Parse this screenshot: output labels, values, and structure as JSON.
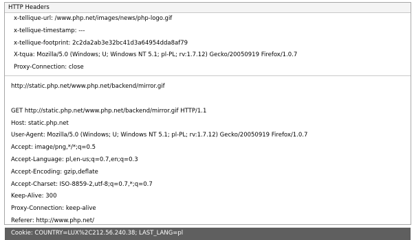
{
  "title": "HTTP Headers",
  "response_headers": [
    "x-tellique-url: /www.php.net/images/news/php-logo.gif",
    "x-tellique-timestamp: ---",
    "x-tellique-footprint: 2c2da2ab3e32bc41d3a64954dda8af79",
    "X-tqua: Mozilla/5.0 (Windows; U; Windows NT 5.1; pl-PL; rv:1.7.12) Gecko/20050919 Firefox/1.0.7",
    "Proxy-Connection: close"
  ],
  "request_url": "http://static.php.net/www.php.net/backend/mirror.gif",
  "request_headers": [
    "GET http://static.php.net/www.php.net/backend/mirror.gif HTTP/1.1",
    "Host: static.php.net",
    "User-Agent: Mozilla/5.0 (Windows; U; Windows NT 5.1; pl-PL; rv:1.7.12) Gecko/20050919 Firefox/1.0.7",
    "Accept: image/png,*/*;q=0.5",
    "Accept-Language: pl,en-us;q=0.7,en;q=0.3",
    "Accept-Encoding: gzip,deflate",
    "Accept-Charset: ISO-8859-2,utf-8;q=0.7,*;q=0.7",
    "Keep-Alive: 300",
    "Proxy-Connection: keep-alive",
    "Referer: http://www.php.net/"
  ],
  "selected_line": "Cookie: COUNTRY=LUX%2C212.56.240.38; LAST_LANG=pl",
  "colors": {
    "selection_background": "#5f5f5f",
    "selection_text": "#ffffff",
    "border": "#a6a6a6"
  }
}
